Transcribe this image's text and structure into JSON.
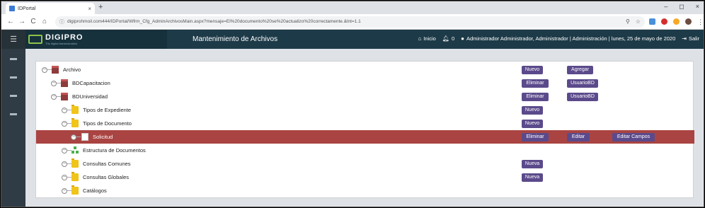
{
  "browser": {
    "tab_title": "IDPortal",
    "tab_close": "×",
    "new_tab": "+",
    "window_controls": [
      "–",
      "◻",
      "×"
    ],
    "url": "digiprohmoil.com444/IDPortal/Wfrm_Cfg_AdminArchivosMain.aspx?mensaje=El%20documento%20se%20actualizo%20correctamente.&lnt=1.1"
  },
  "app": {
    "logo_text": "DIGIPRO",
    "logo_sub": "The digital transformation",
    "title": "Mantenimiento de Archivos",
    "nav_home": "Inicio",
    "notif_count": "0",
    "user": "Administrador Administrador, Administrador | Administración | lunes, 25 de mayo de 2020",
    "logout": "Salir"
  },
  "tree": {
    "archivo": "Archivo",
    "bdcapacitacion": "BDCapacitacion",
    "bduniversidad": "BDUniversidad",
    "tipos_expediente": "Tipos de Expediente",
    "tipos_documento": "Tipos de Documento",
    "solicitud": "Solicitud",
    "estructura": "Estructura de Documentos",
    "consultas_comunes": "Consultas Comunes",
    "consultas_globales": "Consultas Globales",
    "catalogos": "Catálogos"
  },
  "buttons": {
    "nuevo": "Nuevo",
    "agregar": "Agregar",
    "eliminar": "Eliminar",
    "usuariobd": "UsuarioBD",
    "editar": "Editar",
    "editar_campos": "Editar Campos"
  },
  "colors": {
    "header": "#1d3a48",
    "selected_row": "#a94442",
    "button": "#5b4a8b"
  }
}
